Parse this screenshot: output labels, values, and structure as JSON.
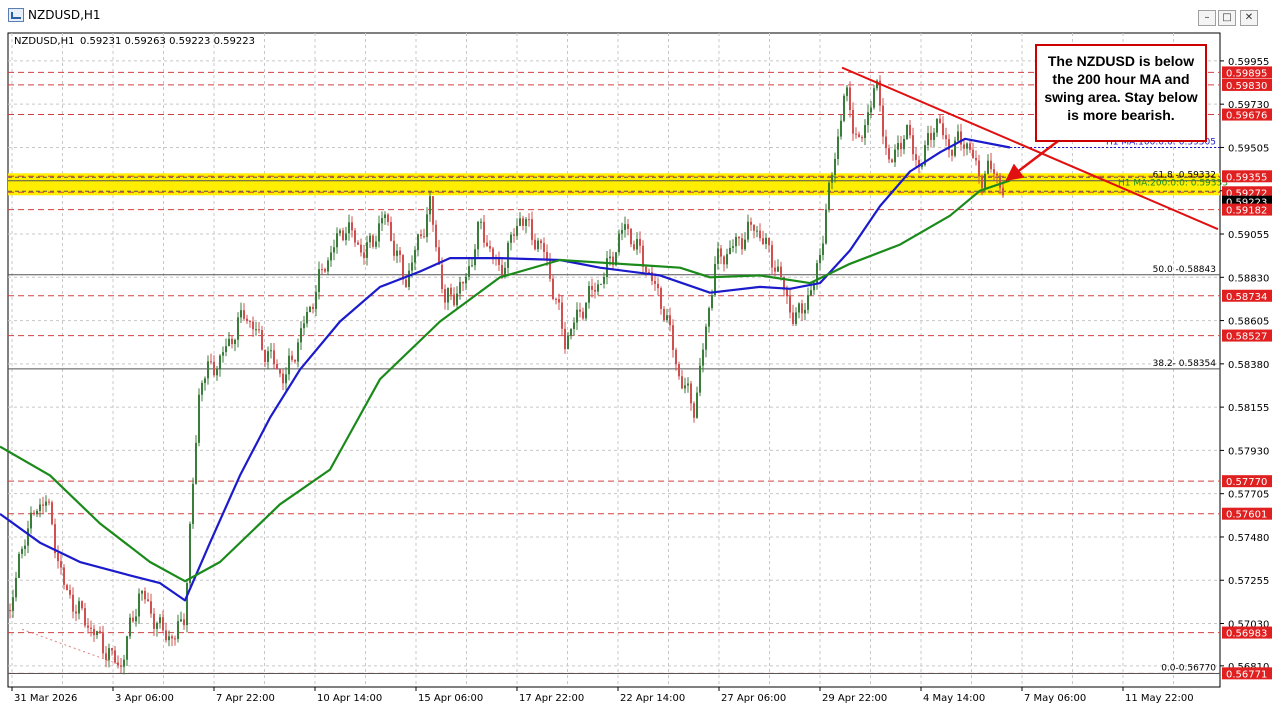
{
  "window": {
    "title": "NZDUSD,H1",
    "symbol_header": "NZDUSD,H1",
    "ohlc": "0.59231 0.59263 0.59223 0.59223"
  },
  "annotation": {
    "text": "The NZDUSD is below the 200 hour MA and swing area.  Stay below is more bearish."
  },
  "colors": {
    "bull_candle": "#3a7d3a",
    "bear_candle": "#d05050",
    "ma100": "#1b1bcc",
    "ma200": "#1a8a1a",
    "trendline": "#e01010",
    "swing_zone": "#ffee00",
    "price_tag": "#e02020",
    "level_dashed": "#d04040"
  },
  "chart_data": {
    "type": "line",
    "title": "",
    "xlabel": "",
    "ylabel": "",
    "ylim": [
      0.567,
      0.601
    ],
    "x_ticks": [
      "31 Mar 2026",
      "3 Apr 06:00",
      "7 Apr 22:00",
      "10 Apr 14:00",
      "15 Apr 06:00",
      "17 Apr 22:00",
      "22 Apr 14:00",
      "27 Apr 06:00",
      "29 Apr 22:00",
      "4 May 14:00",
      "7 May 06:00",
      "11 May 22:00"
    ],
    "y_ticks": [
      "0.59955",
      "0.59730",
      "0.59505",
      "0.59280",
      "0.59055",
      "0.58830",
      "0.58605",
      "0.58380",
      "0.58155",
      "0.57930",
      "0.57705",
      "0.57480",
      "0.57255",
      "0.57030",
      "0.56810"
    ],
    "price_tags": [
      "0.59895",
      "0.59830",
      "0.59676",
      "0.59355",
      "0.59272",
      "0.59223",
      "0.59182",
      "0.58734",
      "0.58527",
      "0.57770",
      "0.57601",
      "0.56983",
      "0.56771"
    ],
    "fib_levels": [
      {
        "label": "61.8 -0.59332",
        "value": 0.59332
      },
      {
        "label": "50.0 -0.58843",
        "value": 0.58843
      },
      {
        "label": "38.2- 0.58354",
        "value": 0.58354
      },
      {
        "label": "0.0-0.56770",
        "value": 0.5677
      }
    ],
    "ma_labels": {
      "ma100": "H1 MA:100:0:0: 0.59505",
      "ma200": "H1 MA:200:0:0: 0.59333"
    },
    "swing_zone": [
      0.59272,
      0.59355
    ],
    "series": [
      {
        "name": "H1 MA:100:0:0: 0.59505",
        "x": [
          0,
          40,
          80,
          130,
          160,
          185,
          210,
          240,
          270,
          300,
          340,
          380,
          420,
          450,
          500,
          560,
          600,
          660,
          710,
          760,
          790,
          820,
          850,
          880,
          910,
          940,
          965,
          1010
        ],
        "y": [
          0.576,
          0.5745,
          0.5735,
          0.5728,
          0.5724,
          0.5715,
          0.5745,
          0.578,
          0.581,
          0.5835,
          0.586,
          0.5878,
          0.5886,
          0.5893,
          0.5893,
          0.5892,
          0.5888,
          0.5884,
          0.5875,
          0.5878,
          0.5877,
          0.588,
          0.5897,
          0.592,
          0.5938,
          0.5948,
          0.5955,
          0.59505
        ]
      },
      {
        "name": "H1 MA:200:0:0: 0.59333",
        "x": [
          0,
          50,
          100,
          150,
          185,
          220,
          280,
          330,
          380,
          440,
          500,
          560,
          620,
          680,
          710,
          760,
          810,
          850,
          900,
          950,
          980,
          1010
        ],
        "y": [
          0.5795,
          0.578,
          0.5755,
          0.5735,
          0.5725,
          0.5735,
          0.5765,
          0.5783,
          0.583,
          0.586,
          0.5883,
          0.5892,
          0.589,
          0.5888,
          0.5883,
          0.5884,
          0.588,
          0.589,
          0.59,
          0.5915,
          0.5928,
          0.59333
        ]
      }
    ],
    "trendline": {
      "x": [
        842,
        1218
      ],
      "y": [
        0.5992,
        0.5908
      ]
    },
    "price_path": {
      "x": [
        10,
        25,
        45,
        65,
        85,
        105,
        120,
        140,
        160,
        175,
        185,
        200,
        220,
        245,
        265,
        285,
        305,
        325,
        345,
        365,
        385,
        405,
        430,
        445,
        465,
        480,
        500,
        520,
        545,
        565,
        585,
        605,
        625,
        645,
        665,
        680,
        695,
        715,
        735,
        755,
        775,
        795,
        815,
        830,
        845,
        860,
        875,
        890,
        905,
        920,
        935,
        950,
        965,
        980,
        995,
        1005
      ],
      "y": [
        0.571,
        0.575,
        0.577,
        0.572,
        0.5705,
        0.569,
        0.568,
        0.572,
        0.57,
        0.5695,
        0.571,
        0.583,
        0.584,
        0.5865,
        0.5845,
        0.583,
        0.586,
        0.589,
        0.591,
        0.5895,
        0.5915,
        0.588,
        0.592,
        0.587,
        0.588,
        0.591,
        0.5885,
        0.5915,
        0.5895,
        0.585,
        0.587,
        0.5885,
        0.591,
        0.589,
        0.5865,
        0.583,
        0.5815,
        0.589,
        0.59,
        0.591,
        0.589,
        0.586,
        0.588,
        0.593,
        0.598,
        0.595,
        0.5985,
        0.594,
        0.596,
        0.594,
        0.5965,
        0.595,
        0.5955,
        0.5935,
        0.594,
        0.59223
      ]
    }
  }
}
